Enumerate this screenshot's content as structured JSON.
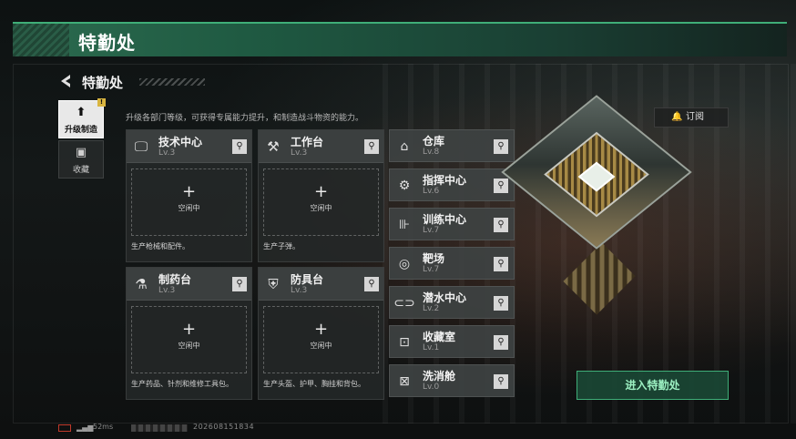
{
  "banner": {
    "title": "特勤处"
  },
  "header": {
    "back_icon": "back-arrow-icon",
    "title": "特勤处",
    "description": "升级各部门等级，可获得专属能力提升，和制造战斗物资的能力。"
  },
  "nav": {
    "items": [
      {
        "label": "升级制造",
        "icon": "upgrade-icon",
        "active": true,
        "badge": "!"
      },
      {
        "label": "收藏",
        "icon": "collection-icon",
        "active": false
      }
    ]
  },
  "big_cards": [
    {
      "name": "技术中心",
      "level": "Lv.3",
      "icon": "monitor-icon",
      "slot_label": "空闲中",
      "description": "生产枪械和配件。"
    },
    {
      "name": "工作台",
      "level": "Lv.3",
      "icon": "tools-icon",
      "slot_label": "空闲中",
      "description": "生产子弹。"
    },
    {
      "name": "制药台",
      "level": "Lv.3",
      "icon": "microscope-icon",
      "slot_label": "空闲中",
      "description": "生产药品、针剂和维修工具包。"
    },
    {
      "name": "防具台",
      "level": "Lv.3",
      "icon": "armor-icon",
      "slot_label": "空闲中",
      "description": "生产头盔、护甲、胸挂和背包。"
    }
  ],
  "small_cards": [
    {
      "name": "仓库",
      "level": "Lv.8",
      "icon": "warehouse-icon"
    },
    {
      "name": "指挥中心",
      "level": "Lv.6",
      "icon": "chip-icon"
    },
    {
      "name": "训练中心",
      "level": "Lv.7",
      "icon": "dumbbell-icon"
    },
    {
      "name": "靶场",
      "level": "Lv.7",
      "icon": "target-icon"
    },
    {
      "name": "潜水中心",
      "level": "Lv.2",
      "icon": "diving-icon"
    },
    {
      "name": "收藏室",
      "level": "Lv.1",
      "icon": "safe-icon"
    },
    {
      "name": "洗消舱",
      "level": "Lv.0",
      "icon": "decon-icon"
    }
  ],
  "subscribe": {
    "label": "订阅",
    "icon": "bell-icon"
  },
  "enter_button": {
    "label": "进入特勤处"
  },
  "status": {
    "ping": "52ms",
    "uid": "202608151834"
  },
  "colors": {
    "accent_green": "#3fae78",
    "banner_green": "#2c6b4f"
  }
}
